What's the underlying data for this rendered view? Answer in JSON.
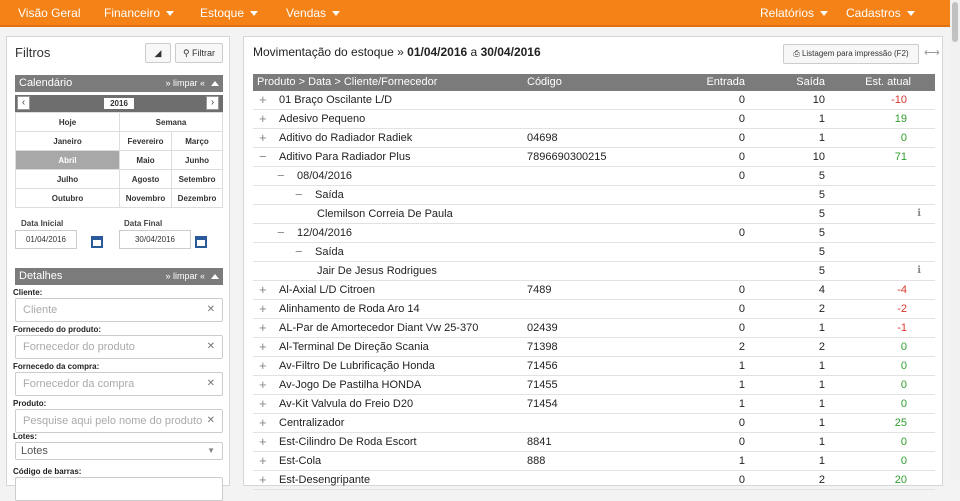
{
  "nav": {
    "left": [
      {
        "label": "Visão Geral",
        "caret": false
      },
      {
        "label": "Financeiro",
        "caret": true
      },
      {
        "label": "Estoque",
        "caret": true
      },
      {
        "label": "Vendas",
        "caret": true
      }
    ],
    "right": [
      {
        "label": "Relatórios",
        "caret": true
      },
      {
        "label": "Cadastros",
        "caret": true
      }
    ]
  },
  "sidebar": {
    "title": "Filtros",
    "filter_button": "Filtrar",
    "calendar": {
      "title": "Calendário",
      "clear": "» limpar «",
      "year": "2016",
      "today": "Hoje",
      "week": "Semana",
      "months": [
        "Janeiro",
        "Fevereiro",
        "Março",
        "Abril",
        "Maio",
        "Junho",
        "Julho",
        "Agosto",
        "Setembro",
        "Outubro",
        "Novembro",
        "Dezembro"
      ],
      "selected_month": "Abril",
      "start_label": "Data Inicial",
      "end_label": "Data Final",
      "start_value": "01/04/2016",
      "end_value": "30/04/2016"
    },
    "details": {
      "title": "Detalhes",
      "clear": "» limpar «",
      "fields": [
        {
          "label": "Cliente:",
          "placeholder": "Cliente"
        },
        {
          "label": "Fornecedo do produto:",
          "placeholder": "Fornecedor do produto"
        },
        {
          "label": "Fornecedo da compra:",
          "placeholder": "Fornecedor da compra"
        },
        {
          "label": "Produto:",
          "placeholder": "Pesquise aqui pelo nome do produto"
        }
      ],
      "lotes_label": "Lotes:",
      "lotes_value": "Lotes",
      "barcode_label": "Código de barras:"
    }
  },
  "main": {
    "title_prefix": "Movimentação do estoque",
    "title_sep": "»",
    "date_from": "01/04/2016",
    "date_conj": "a",
    "date_to": "30/04/2016",
    "print_button": "Listagem para impressão (F2)",
    "columns": [
      "Produto > Data > Cliente/Fornecedor",
      "Código",
      "Entrada",
      "Saída",
      "Est. atual"
    ],
    "rows": [
      {
        "level": 0,
        "toggle": "+",
        "name": "01 Braço Oscilante L/D",
        "code": "",
        "in": "0",
        "out": "10",
        "stock": "-10"
      },
      {
        "level": 0,
        "toggle": "+",
        "name": "Adesivo Pequeno",
        "code": "",
        "in": "0",
        "out": "1",
        "stock": "19"
      },
      {
        "level": 0,
        "toggle": "+",
        "name": "Aditivo do Radiador Radiek",
        "code": "04698",
        "in": "0",
        "out": "1",
        "stock": "0"
      },
      {
        "level": 0,
        "toggle": "−",
        "name": "Aditivo Para Radiador Plus",
        "code": "7896690300215",
        "in": "0",
        "out": "10",
        "stock": "71"
      },
      {
        "level": 1,
        "toggle": "−",
        "name": "08/04/2016",
        "code": "",
        "in": "0",
        "out": "5",
        "stock": ""
      },
      {
        "level": 2,
        "toggle": "−",
        "name": "Saída",
        "code": "",
        "in": "",
        "out": "5",
        "stock": ""
      },
      {
        "level": 3,
        "toggle": "",
        "name": "Clemilson Correia De Paula",
        "code": "",
        "in": "",
        "out": "5",
        "stock": "",
        "info": true
      },
      {
        "level": 1,
        "toggle": "−",
        "name": "12/04/2016",
        "code": "",
        "in": "0",
        "out": "5",
        "stock": ""
      },
      {
        "level": 2,
        "toggle": "−",
        "name": "Saída",
        "code": "",
        "in": "",
        "out": "5",
        "stock": ""
      },
      {
        "level": 3,
        "toggle": "",
        "name": "Jair De Jesus Rodrigues",
        "code": "",
        "in": "",
        "out": "5",
        "stock": "",
        "info": true
      },
      {
        "level": 0,
        "toggle": "+",
        "name": "Al-Axial L/D Citroen",
        "code": "7489",
        "in": "0",
        "out": "4",
        "stock": "-4"
      },
      {
        "level": 0,
        "toggle": "+",
        "name": "Alinhamento de Roda Aro 14",
        "code": "",
        "in": "0",
        "out": "2",
        "stock": "-2"
      },
      {
        "level": 0,
        "toggle": "+",
        "name": "AL-Par de Amortecedor Diant Vw 25-370",
        "code": "02439",
        "in": "0",
        "out": "1",
        "stock": "-1"
      },
      {
        "level": 0,
        "toggle": "+",
        "name": "Al-Terminal De Direção Scania",
        "code": "71398",
        "in": "2",
        "out": "2",
        "stock": "0"
      },
      {
        "level": 0,
        "toggle": "+",
        "name": "Av-Filtro De Lubrificação Honda",
        "code": "71456",
        "in": "1",
        "out": "1",
        "stock": "0"
      },
      {
        "level": 0,
        "toggle": "+",
        "name": "Av-Jogo De Pastilha HONDA",
        "code": "71455",
        "in": "1",
        "out": "1",
        "stock": "0"
      },
      {
        "level": 0,
        "toggle": "+",
        "name": "Av-Kit Valvula do Freio D20",
        "code": "71454",
        "in": "1",
        "out": "1",
        "stock": "0"
      },
      {
        "level": 0,
        "toggle": "+",
        "name": "Centralizador",
        "code": "",
        "in": "0",
        "out": "1",
        "stock": "25"
      },
      {
        "level": 0,
        "toggle": "+",
        "name": "Est-Cilindro De Roda Escort",
        "code": "8841",
        "in": "0",
        "out": "1",
        "stock": "0"
      },
      {
        "level": 0,
        "toggle": "+",
        "name": "Est-Cola",
        "code": "888",
        "in": "1",
        "out": "1",
        "stock": "0"
      },
      {
        "level": 0,
        "toggle": "+",
        "name": "Est-Desengripante",
        "code": "",
        "in": "0",
        "out": "2",
        "stock": "20"
      }
    ]
  }
}
